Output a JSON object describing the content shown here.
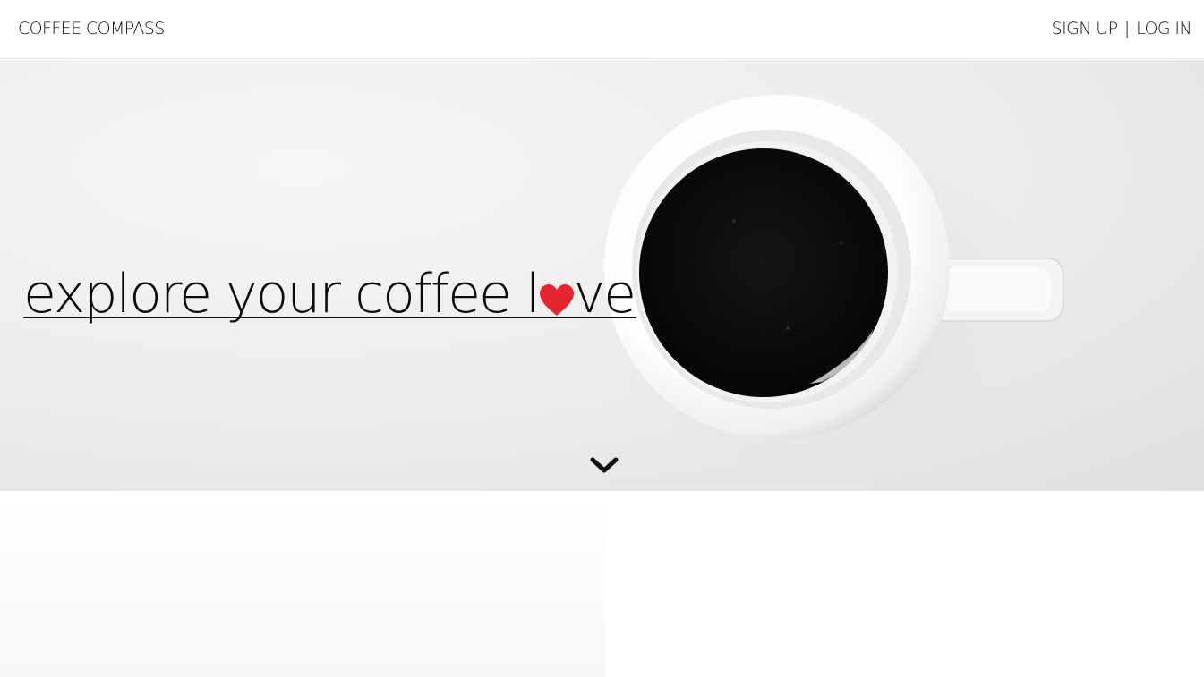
{
  "navbar": {
    "brand": "COFFEE COMPASS",
    "sign_up": "SIGN UP",
    "separator": "|",
    "log_in": "LOG IN"
  },
  "hero": {
    "tagline_before": "explore your coffee l",
    "tagline_after": "ve",
    "heart_icon": "heart-icon",
    "heart_color": "#e3262f",
    "scroll_icon": "chevron-down-icon"
  }
}
